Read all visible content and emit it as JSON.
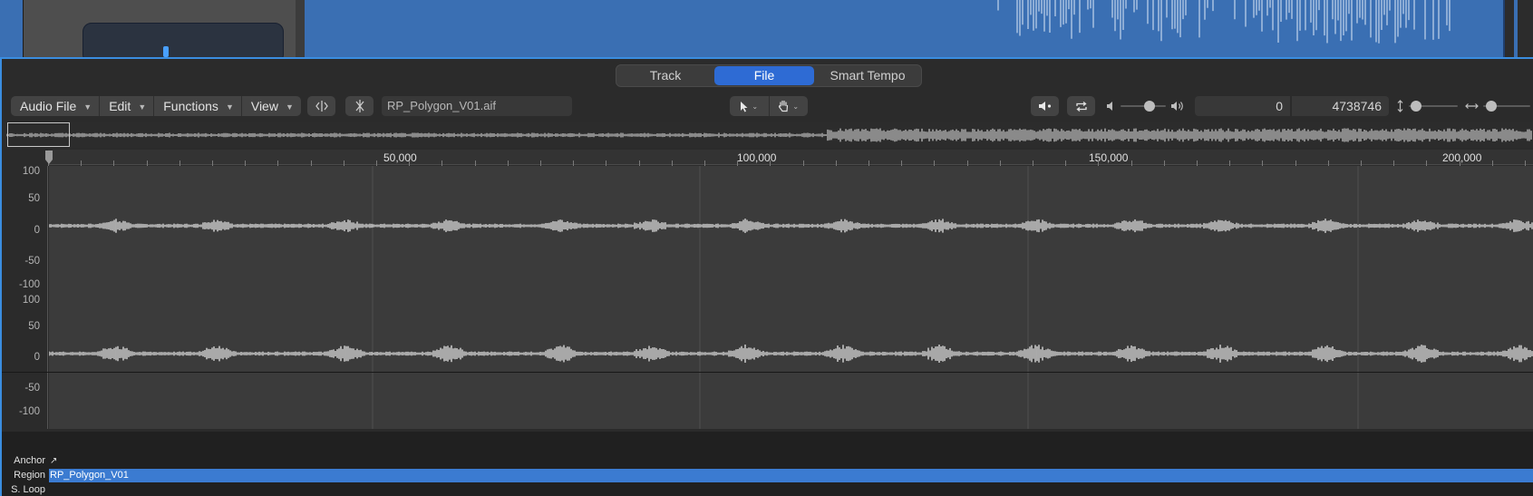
{
  "editor": {
    "tabs": [
      {
        "label": "Track",
        "active": false
      },
      {
        "label": "File",
        "active": true
      },
      {
        "label": "Smart Tempo",
        "active": false
      }
    ],
    "menus": [
      {
        "label": "Audio File"
      },
      {
        "label": "Edit"
      },
      {
        "label": "Functions"
      },
      {
        "label": "View"
      }
    ],
    "filename": "RP_Polygon_V01.aif",
    "selection_start": "0",
    "selection_length": "4738746",
    "ruler": {
      "labels": [
        "50,000",
        "100,000",
        "150,000",
        "200,000"
      ]
    },
    "amplitude_scale": [
      "100",
      "50",
      "0",
      "-50",
      "-100"
    ],
    "lanes": {
      "anchor_label": "Anchor",
      "region_label": "Region",
      "loop_label": "S. Loop",
      "region_name": "RP_Polygon_V01"
    },
    "colors": {
      "accent": "#2e6bd4",
      "region": "#3b7bd1",
      "focus_border": "#3a8de0"
    },
    "icons": {
      "mute": "speaker-mute-icon",
      "loop": "loop-icon",
      "pointer_tool": "pointer-icon",
      "hand_tool": "hand-icon"
    }
  }
}
